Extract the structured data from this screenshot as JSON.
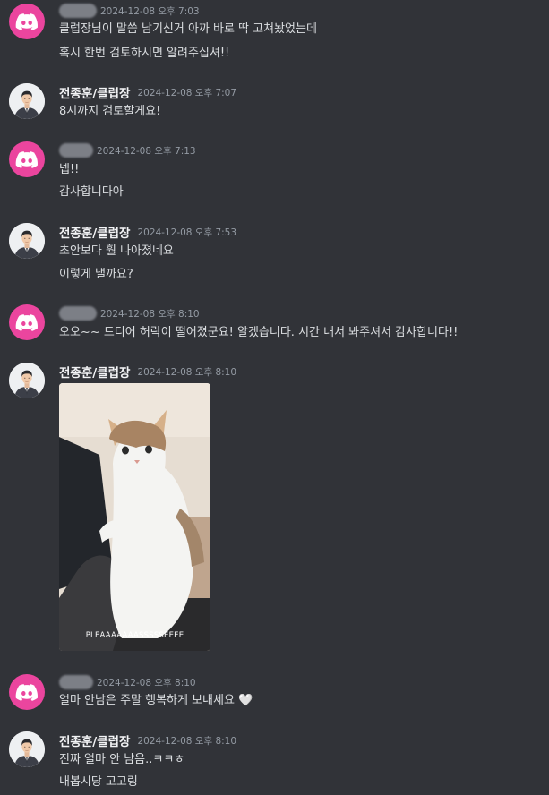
{
  "messages": [
    {
      "author": "",
      "author_blurred": true,
      "avatar": "discord-logo-icon",
      "timestamp": "2024-12-08 오후 7:03",
      "lines": [
        "클럽장님이 말씀 남기신거 아까 바로 딱 고쳐놨었는데",
        "혹시 한번 검토하시면 알려주십셔!!"
      ]
    },
    {
      "author": "전종훈/클럽장",
      "avatar": "profile-photo",
      "timestamp": "2024-12-08 오후 7:07",
      "lines": [
        "8시까지 검토할게요!"
      ]
    },
    {
      "author": "",
      "author_blurred": true,
      "avatar": "discord-logo-icon",
      "timestamp": "2024-12-08 오후 7:13",
      "lines": [
        "넵!!",
        "감사합니다아"
      ]
    },
    {
      "author": "전종훈/클럽장",
      "avatar": "profile-photo",
      "timestamp": "2024-12-08 오후 7:53",
      "lines": [
        "초안보다 훨 나아졌네요",
        "이렇게 낼까요?"
      ]
    },
    {
      "author": "",
      "author_blurred": true,
      "avatar": "discord-logo-icon",
      "timestamp": "2024-12-08 오후 8:10",
      "lines": [
        "오오~~ 드디어 허락이 떨어졌군요! 알겠습니다. 시간 내서 봐주셔서 감사합니다!!"
      ]
    },
    {
      "author": "전종훈/클럽장",
      "avatar": "profile-photo",
      "timestamp": "2024-12-08 오후 8:10",
      "attachment": {
        "type": "gif",
        "caption": "PLEAAAAAAASSSSSEEEE"
      }
    },
    {
      "author": "",
      "author_blurred": true,
      "avatar": "discord-logo-icon",
      "timestamp": "2024-12-08 오후 8:10",
      "lines": [
        "얼마 안남은 주말 행복하게 보내세요 🤍"
      ]
    },
    {
      "author": "전종훈/클럽장",
      "avatar": "profile-photo",
      "timestamp": "2024-12-08 오후 8:10",
      "lines": [
        "진짜 얼마 안 남음..ㅋㅋㅎ",
        "내봅시당 고고링"
      ]
    }
  ],
  "colors": {
    "background": "#313338",
    "discord_avatar": "#eb459e",
    "text": "#dbdee1",
    "username": "#f2f3f5",
    "timestamp": "#949ba4"
  }
}
